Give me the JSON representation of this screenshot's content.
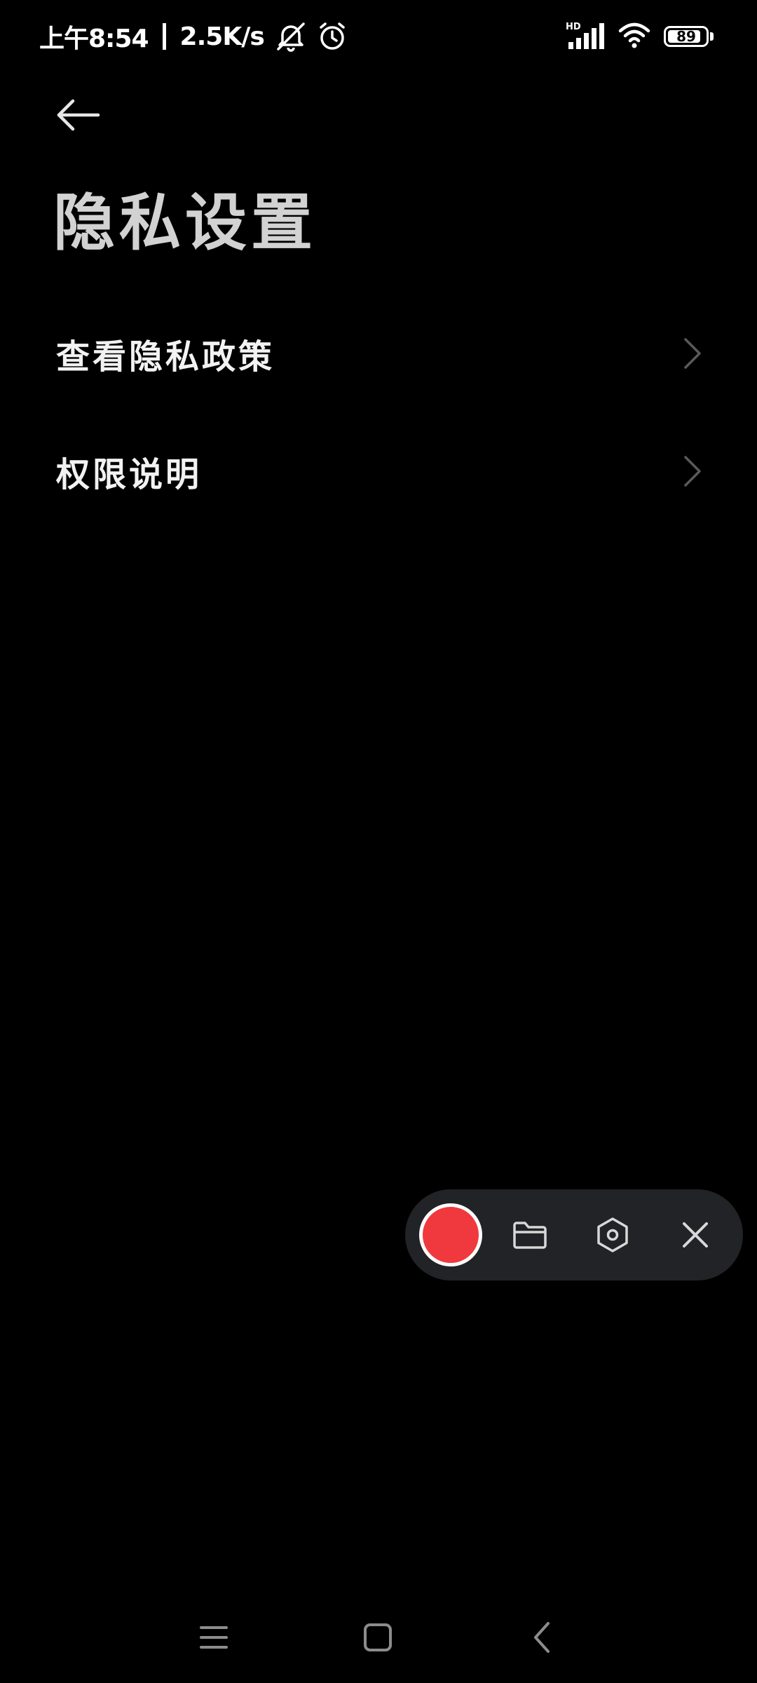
{
  "status_bar": {
    "time": "上午8:54",
    "network_speed": "2.5K/s",
    "network_type": "HD",
    "battery_level": 89,
    "battery_text": "89",
    "icons": [
      "mute-icon",
      "alarm-icon",
      "signal-icon",
      "wifi-icon",
      "battery-icon"
    ]
  },
  "header": {
    "back_icon": "arrow-left-icon",
    "title": "隐私设置"
  },
  "menu": {
    "items": [
      {
        "label": "查看隐私政策",
        "icon": "chevron-right-icon"
      },
      {
        "label": "权限说明",
        "icon": "chevron-right-icon"
      }
    ]
  },
  "recorder_toolbar": {
    "record_color": "#f0393e",
    "tools": [
      "record-icon",
      "folder-icon",
      "hexagon-settings-icon",
      "close-icon"
    ]
  },
  "nav_bar": {
    "buttons": [
      "menu-icon",
      "home-icon",
      "back-icon"
    ]
  },
  "colors": {
    "background": "#000000",
    "title": "#d2d2d2",
    "text": "#f2f2f2",
    "chevron": "#5a5a5a",
    "toolbar_bg": "#222326",
    "record": "#f0393e"
  }
}
